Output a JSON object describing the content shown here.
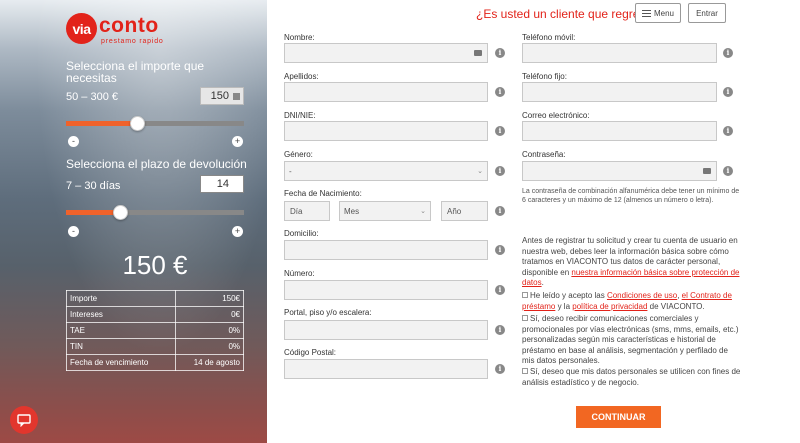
{
  "brand": {
    "badge": "via",
    "name": "conto",
    "tagline": "prestamo rapido",
    "color": "#e2231a"
  },
  "header": {
    "returning_link": "¿Es usted un cliente que regresa",
    "menu_label": "Menu",
    "enter_label": "Entrar"
  },
  "calculator": {
    "amount_title": "Selecciona el importe que necesitas",
    "amount_range": "50 – 300 €",
    "amount_value": "150",
    "amount_slider_fraction": 0.4,
    "term_title": "Selecciona el plazo de devolución",
    "term_range": "7 – 30 días",
    "term_value": "14",
    "term_slider_fraction": 0.304,
    "minus": "-",
    "plus": "+",
    "total": "150 €",
    "accent_color": "#f0622b",
    "summary": [
      {
        "label": "Importe",
        "value": "150€"
      },
      {
        "label": "Intereses",
        "value": "0€"
      },
      {
        "label": "TAE",
        "value": "0%"
      },
      {
        "label": "TIN",
        "value": "0%"
      },
      {
        "label": "Fecha de vencimiento",
        "value": "14 de agosto"
      }
    ]
  },
  "form": {
    "nombre": "Nombre:",
    "apellidos": "Apellidos:",
    "dni": "DNI/NIE:",
    "genero": "Género:",
    "genero_value": "-",
    "fecha": "Fecha de Nacimiento:",
    "dia_placeholder": "Día",
    "mes_value": "Mes",
    "anio_placeholder": "Año",
    "domicilio": "Domicilio:",
    "numero": "Número:",
    "portal": "Portal, piso y/o escalera:",
    "codigo_postal": "Código Postal:",
    "telefono_movil": "Teléfono móvil:",
    "telefono_fijo": "Teléfono fijo:",
    "correo": "Correo electrónico:",
    "contrasena": "Contraseña:",
    "password_hint": "La contraseña de combinación alfanumérica debe tener un mínimo de 6 caracteres y un máximo de 12 (almenos un número o letra).",
    "info_glyph": "i"
  },
  "legal": {
    "intro": "Antes de registrar tu solicitud y crear tu cuenta de usuario en nuestra web, debes leer la información básica sobre cómo tratamos en VIACONTO tus datos de carácter personal, disponible en ",
    "intro_link": "nuestra información básica sobre protección de datos",
    "intro_end": ".",
    "terms_pre": "He leído y acepto las ",
    "terms_link1": "Condiciones de uso",
    "terms_sep1": ", ",
    "terms_link2": "el Contrato de préstamo",
    "terms_sep2": " y la ",
    "terms_link3": "política de privacidad",
    "terms_end": " de VIACONTO.",
    "marketing": "Sí, deseo recibir comunicaciones comerciales y promocionales por vías electrónicas (sms, mms, emails, etc.) personalizadas según mis características e historial de préstamo en base al análisis, segmentación y perfilado de mis datos personales.",
    "analytics": "Sí, deseo que mis datos personales se utilicen con fines de análisis estadístico y de negocio."
  },
  "actions": {
    "continue_label": "CONTINUAR",
    "continue_color": "#f26722"
  }
}
